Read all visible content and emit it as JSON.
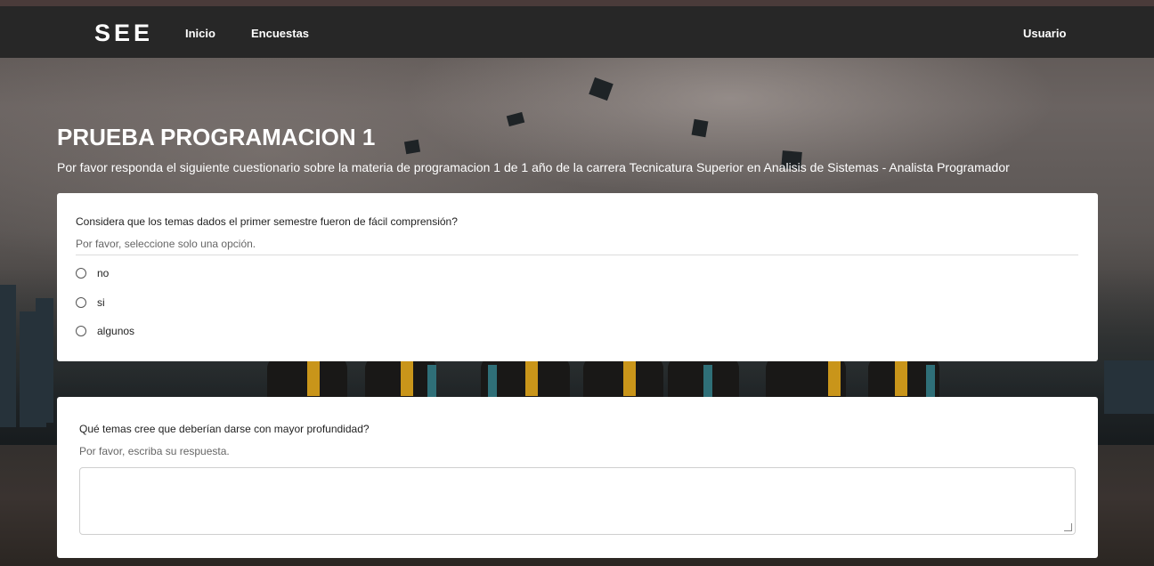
{
  "navbar": {
    "brand": "SEE",
    "links": [
      "Inicio",
      "Encuestas"
    ],
    "user": "Usuario"
  },
  "survey": {
    "title": "PRUEBA PROGRAMACION 1",
    "description": "Por favor responda el siguiente cuestionario sobre la materia de programacion 1 de 1 año de la carrera Tecnicatura Superior en Analisis de Sistemas - Analista Programador"
  },
  "questions": [
    {
      "text": "Considera que los temas dados el primer semestre fueron de fácil comprensión?",
      "hint": "Por favor, seleccione solo una opción.",
      "options": [
        "no",
        "si",
        "algunos"
      ]
    },
    {
      "text": "Qué temas cree que deberían darse con mayor profundidad?",
      "hint": "Por favor, escriba su respuesta.",
      "answer_value": ""
    }
  ],
  "colors": {
    "navbar_bg": "#272727",
    "card_bg": "#ffffff",
    "text_white": "#ffffff"
  }
}
